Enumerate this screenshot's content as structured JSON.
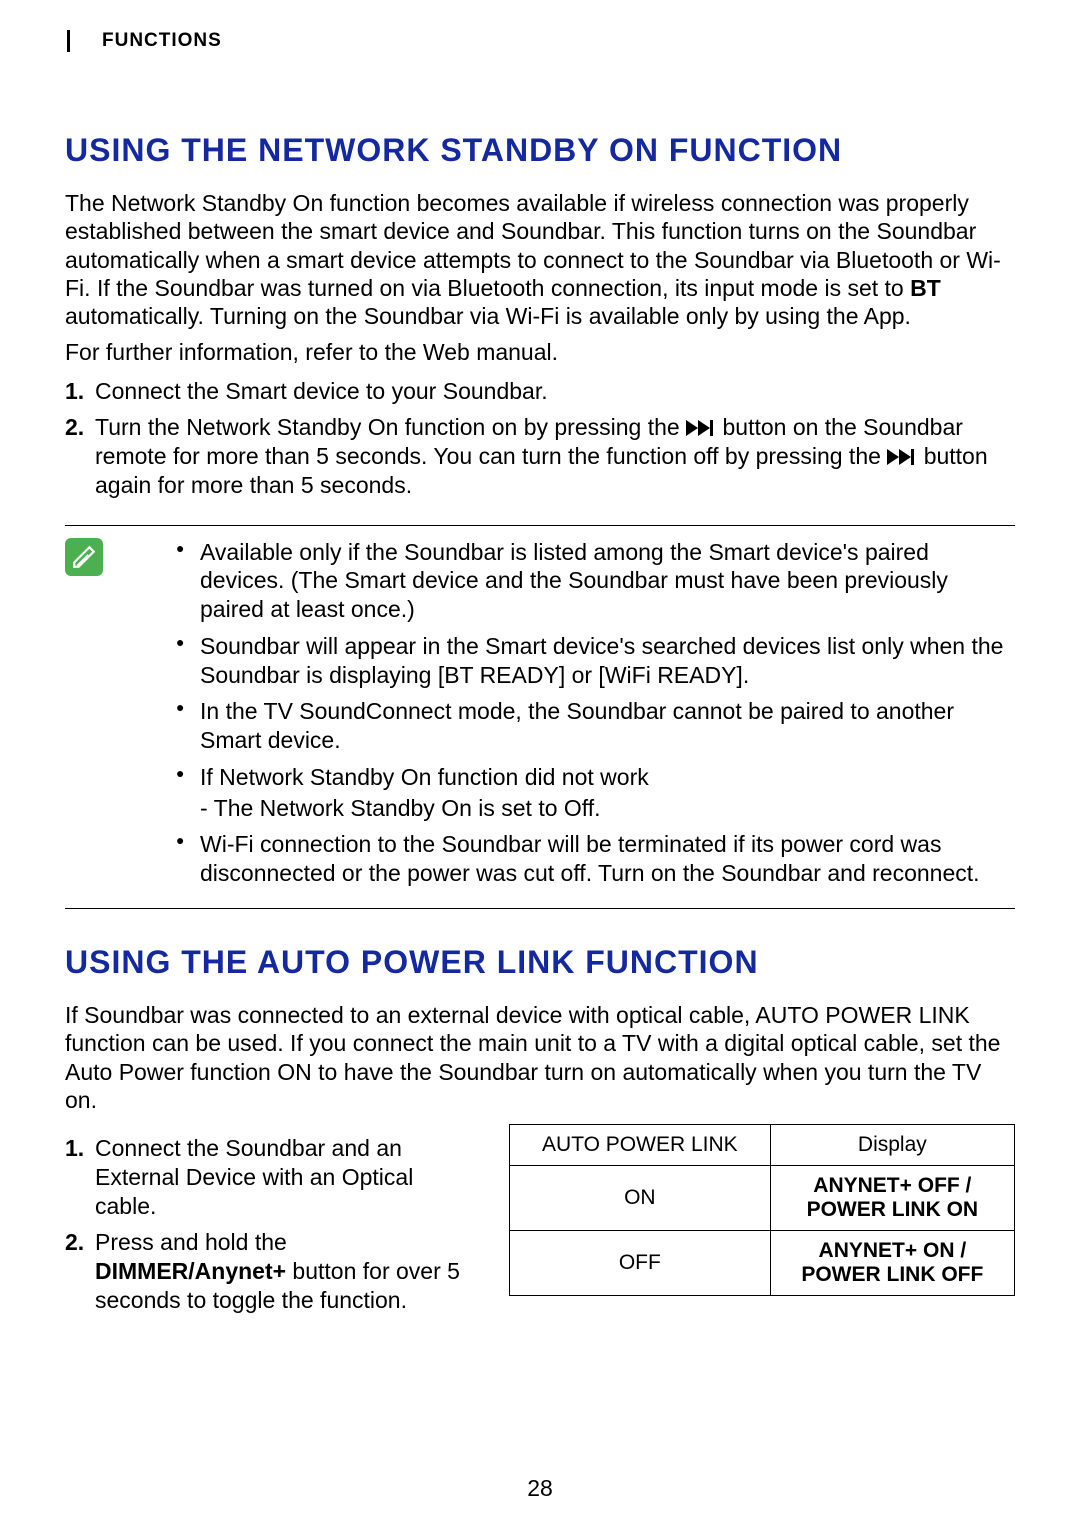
{
  "page_number": "28",
  "section_tab": "FUNCTIONS",
  "net_standby": {
    "heading": "USING THE NETWORK STANDBY ON FUNCTION",
    "intro_1": "The Network Standby On function becomes available if wireless connection was properly established between the smart device and Soundbar. This function turns on the Soundbar automatically when a smart device attempts to connect to the Soundbar via Bluetooth or Wi-Fi. If the Soundbar was turned on via Bluetooth connection, its input mode is set to ",
    "intro_bt": "BT",
    "intro_2": " automatically. Turning on the Soundbar via Wi-Fi is available only by using the App.",
    "intro_3": "For further information, refer to the Web manual.",
    "step1": "Connect the Smart device to your Soundbar.",
    "step2_a": "Turn the Network Standby On function on by pressing the ",
    "step2_b": " button on the Soundbar remote for more than 5 seconds. You can turn the function off by pressing the ",
    "step2_c": " button again for more than 5 seconds.",
    "notes": {
      "n1": "Available only if the Soundbar is listed among the Smart device's paired devices. (The Smart device and the Soundbar must have been previously paired at least once.)",
      "n2": "Soundbar will appear in the Smart device's searched devices list only when the Soundbar is displaying [BT READY] or [WiFi READY].",
      "n3": "In the TV SoundConnect mode, the Soundbar cannot be paired to another Smart device.",
      "n4": "If Network Standby On function did not work",
      "n4_sub": "The Network Standby On is set to Off.",
      "n5": "Wi-Fi connection to the Soundbar will be terminated if its power cord was disconnected or the power was cut off. Turn on the Soundbar and reconnect."
    }
  },
  "auto_power": {
    "heading": "USING THE AUTO POWER LINK FUNCTION",
    "intro": "If Soundbar was connected to an external device with optical cable, AUTO POWER LINK function can be used. If you connect the main unit to a TV with a digital optical cable, set the Auto Power function ON to have the Soundbar turn on automatically when you turn the TV on.",
    "step1": "Connect the Soundbar and an External Device with an Optical cable.",
    "step2_a": "Press and hold the ",
    "step2_bold": "DIMMER/Anynet+",
    "step2_b": " button for over 5 seconds to toggle the function.",
    "table": {
      "h1": "AUTO POWER LINK",
      "h2": "Display",
      "r1c1": "ON",
      "r1c2a": "ANYNET+ OFF /",
      "r1c2b": "POWER LINK ON",
      "r2c1": "OFF",
      "r2c2a": "ANYNET+ ON /",
      "r2c2b": "POWER LINK OFF"
    }
  }
}
